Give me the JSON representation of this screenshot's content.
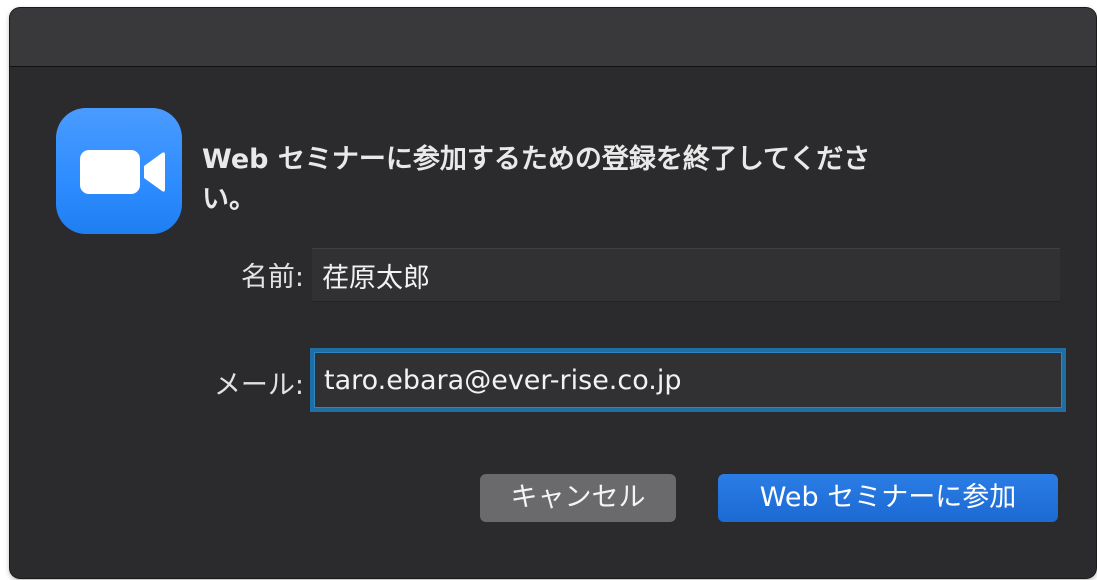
{
  "dialog": {
    "message": "Web セミナーに参加するための登録を終了してください。",
    "app_icon": "zoom-video-camera-icon",
    "accent_color": "#2d8cff"
  },
  "form": {
    "name_label": "名前:",
    "name_value": "荏原太郎",
    "email_label": "メール:",
    "email_value": "taro.ebara@ever-rise.co.jp",
    "focus_color": "#1e6fa4"
  },
  "buttons": {
    "cancel_label": "キャンセル",
    "join_label": "Web セミナーに参加",
    "join_color": "#1f6fd6"
  }
}
